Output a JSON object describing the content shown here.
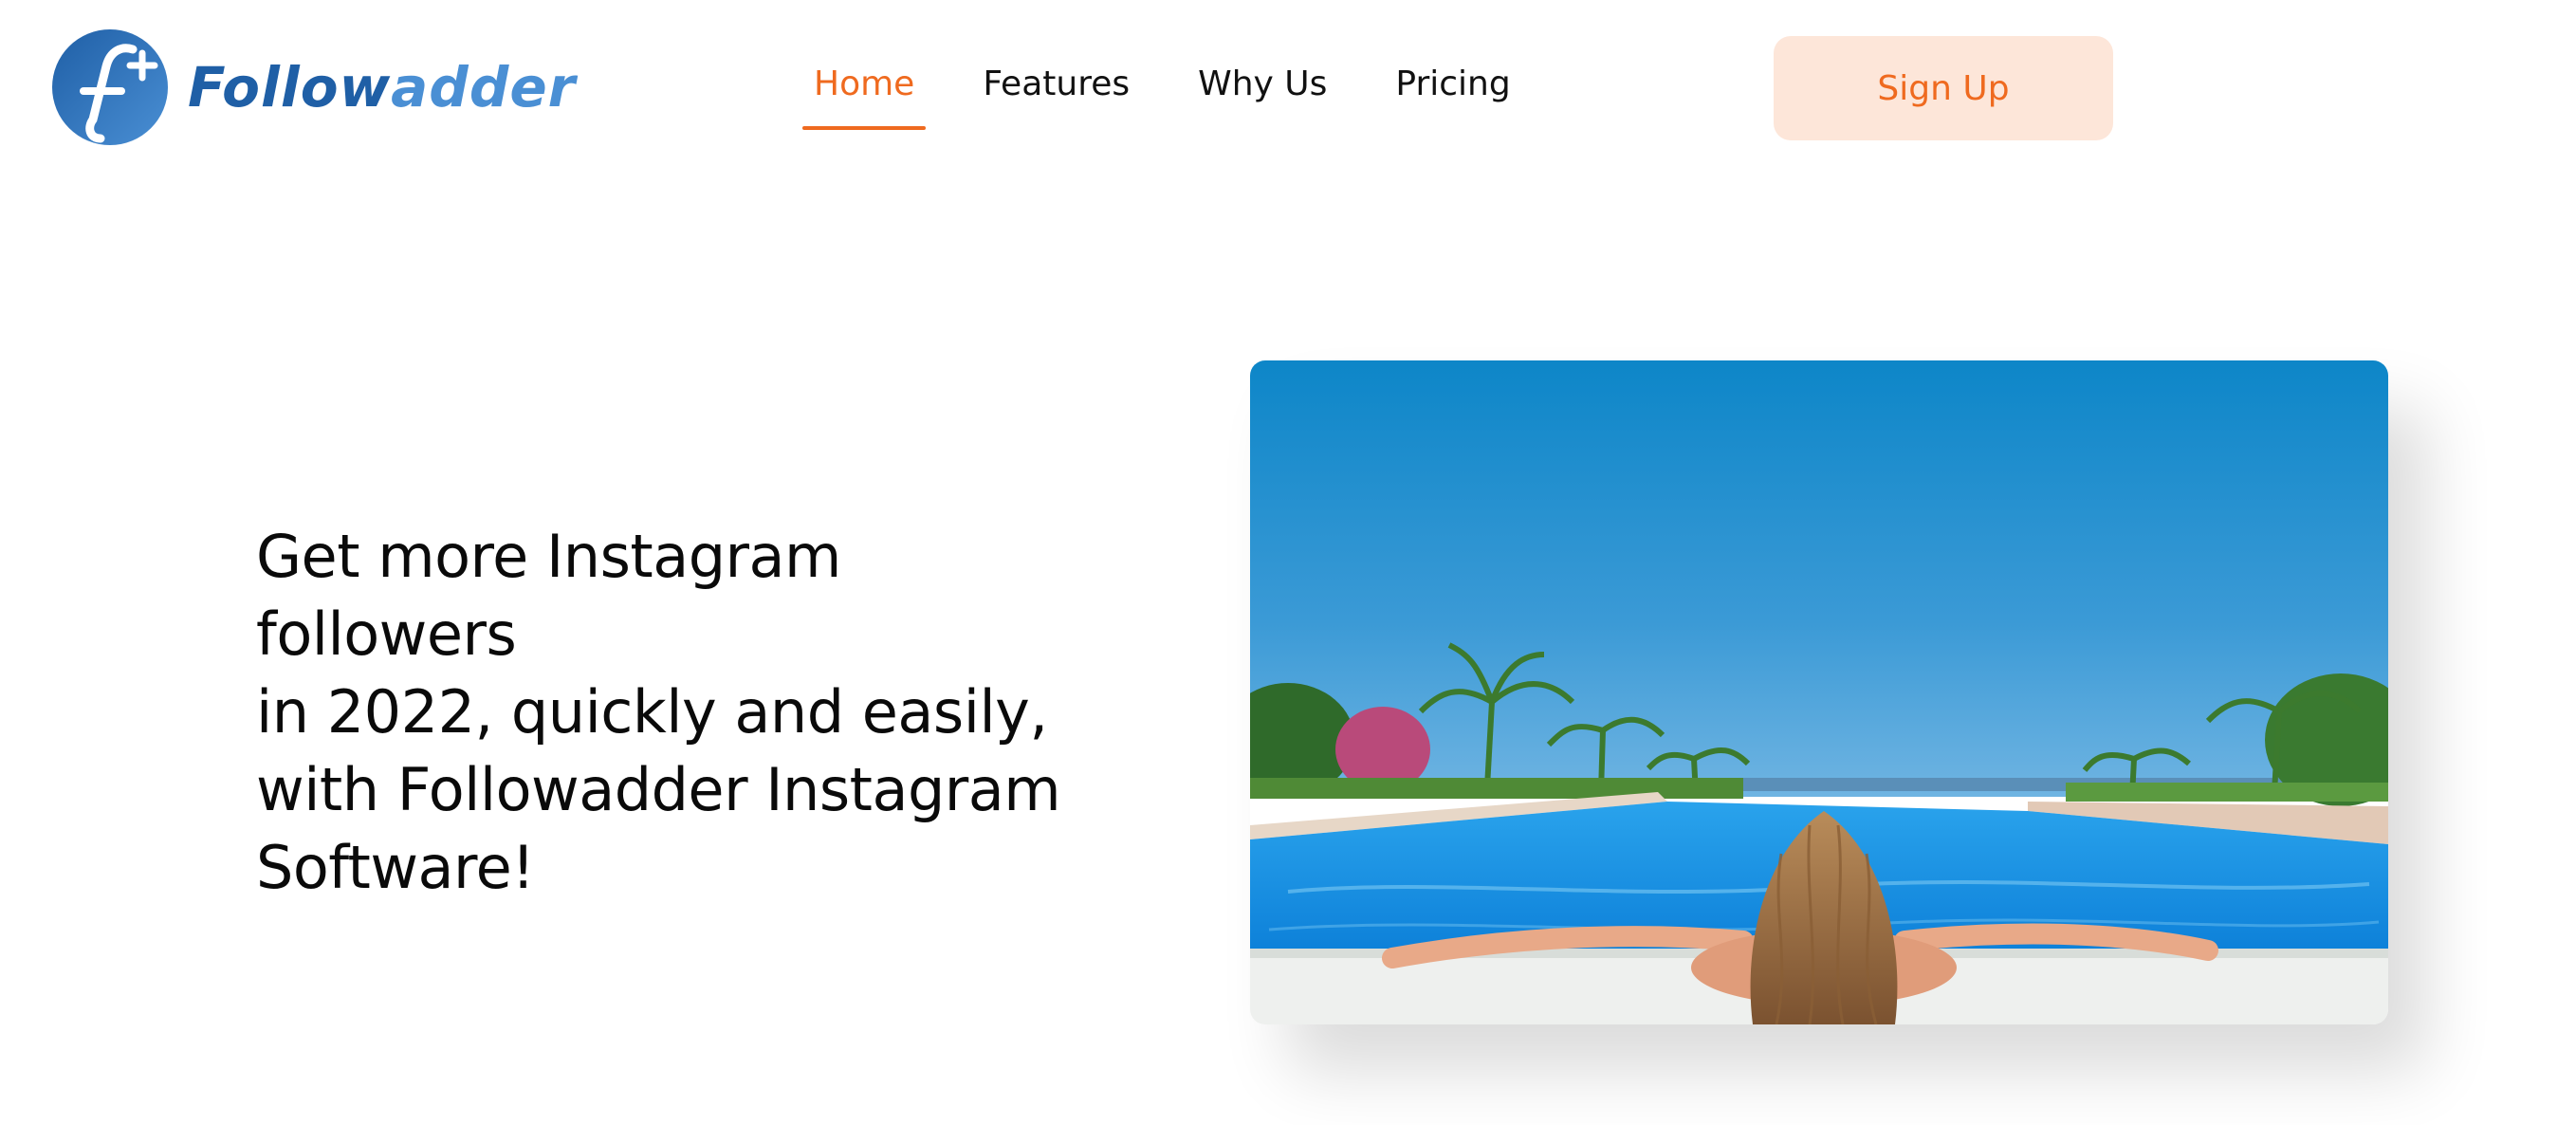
{
  "brand": {
    "logo_letter": "f",
    "logo_plus": "+",
    "name_part1": "Follow",
    "name_part2": "adder",
    "primary_color": "#1f5fa6",
    "secondary_color": "#4a8fd4"
  },
  "nav": {
    "items": [
      {
        "label": "Home",
        "active": true
      },
      {
        "label": "Features",
        "active": false
      },
      {
        "label": "Why Us",
        "active": false
      },
      {
        "label": "Pricing",
        "active": false
      }
    ],
    "accent_color": "#ef6a1f"
  },
  "header": {
    "signup_label": "Sign Up"
  },
  "hero": {
    "heading_lines": [
      "Get more Instagram followers",
      "in 2022, quickly and easily,",
      "with Followadder Instagram",
      "Software!"
    ],
    "image_subject": "woman-in-infinity-pool-photo"
  }
}
